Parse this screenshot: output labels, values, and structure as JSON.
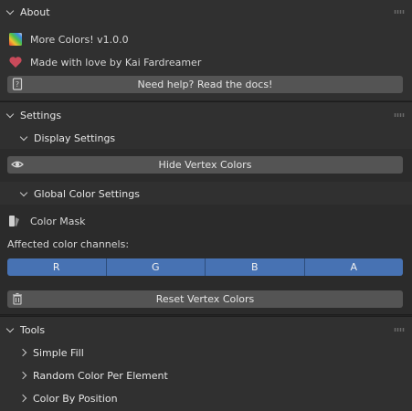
{
  "about": {
    "title": "About",
    "version_text": "More Colors! v1.0.0",
    "love_text": "Made with love by Kai Fardreamer",
    "docs_button": "Need help? Read the docs!"
  },
  "settings": {
    "title": "Settings",
    "display": {
      "title": "Display Settings",
      "hide_button": "Hide Vertex Colors"
    },
    "global": {
      "title": "Global Color Settings",
      "color_mask_label": "Color Mask",
      "affected_label": "Affected color channels:",
      "channels": [
        "R",
        "G",
        "B",
        "A"
      ],
      "reset_button": "Reset Vertex Colors"
    }
  },
  "tools": {
    "title": "Tools",
    "items": [
      "Simple Fill",
      "Random Color Per Element",
      "Color By Position"
    ]
  },
  "colors": {
    "panel_bg": "#303030",
    "button_bg": "#545454",
    "channel_active": "#4772b3",
    "heart": "#c84a5a"
  }
}
